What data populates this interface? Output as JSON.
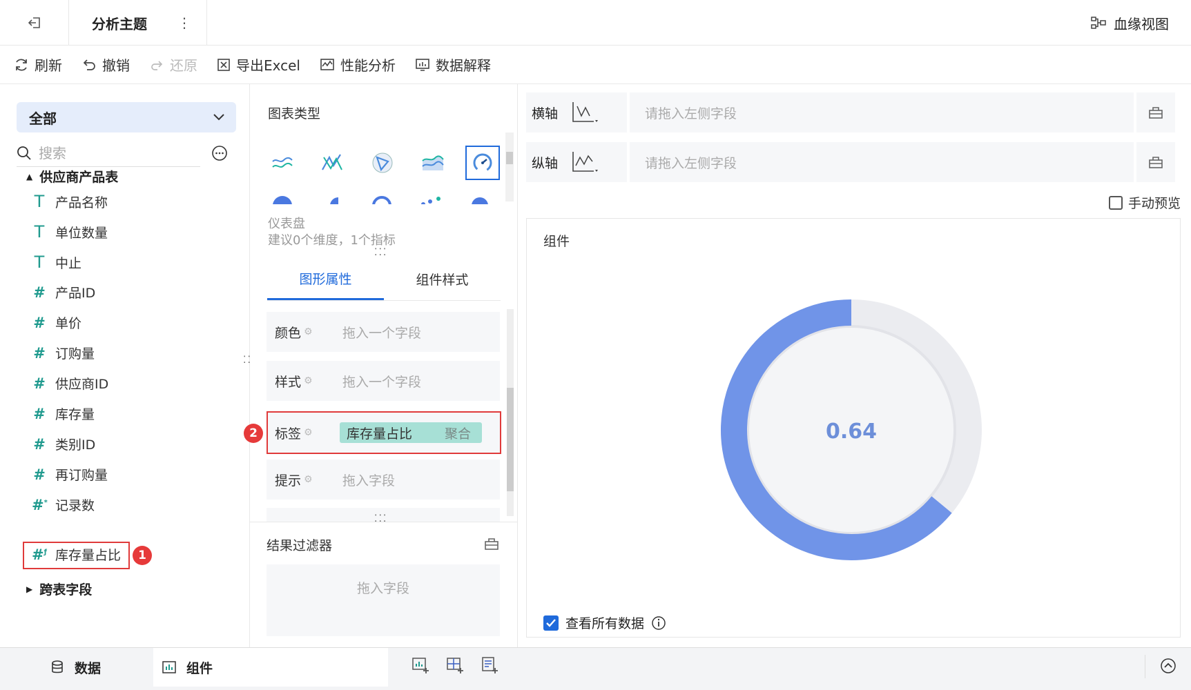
{
  "header": {
    "title": "分析主题",
    "lineage_label": "血缘视图"
  },
  "toolbar": {
    "refresh": "刷新",
    "undo": "撤销",
    "redo": "还原",
    "export_excel": "导出Excel",
    "performance": "性能分析",
    "explain": "数据解释"
  },
  "left": {
    "selector": "全部",
    "search_placeholder": "搜索",
    "table_name": "供应商产品表",
    "fields": [
      {
        "type": "text",
        "name": "产品名称"
      },
      {
        "type": "text",
        "name": "单位数量"
      },
      {
        "type": "text",
        "name": "中止"
      },
      {
        "type": "number",
        "name": "产品ID"
      },
      {
        "type": "number",
        "name": "单价"
      },
      {
        "type": "number",
        "name": "订购量"
      },
      {
        "type": "number",
        "name": "供应商ID"
      },
      {
        "type": "number",
        "name": "库存量"
      },
      {
        "type": "number",
        "name": "类别ID"
      },
      {
        "type": "number",
        "name": "再订购量"
      },
      {
        "type": "count",
        "name": "记录数"
      },
      {
        "type": "calc",
        "name": "库存量占比"
      }
    ],
    "cross_table": "跨表字段",
    "badge1": "1"
  },
  "middle": {
    "chart_type_label": "图表类型",
    "chart_name": "仪表盘",
    "chart_hint": "建议0个维度，1个指标",
    "tabs": [
      "图形属性",
      "组件样式"
    ],
    "props": {
      "color": {
        "label": "颜色",
        "placeholder": "拖入一个字段"
      },
      "style": {
        "label": "样式",
        "placeholder": "拖入一个字段"
      },
      "label": {
        "label": "标签",
        "chip": "库存量占比",
        "chip_agg": "聚合"
      },
      "tooltip": {
        "label": "提示",
        "placeholder": "拖入字段"
      }
    },
    "badge2": "2",
    "filter_label": "结果过滤器",
    "filter_placeholder": "拖入字段"
  },
  "right": {
    "x_axis": {
      "label": "横轴",
      "placeholder": "请拖入左侧字段"
    },
    "y_axis": {
      "label": "纵轴",
      "placeholder": "请拖入左侧字段"
    },
    "manual_preview": "手动预览",
    "component_title": "组件",
    "gauge_value": "0.64",
    "gauge_fraction": 0.64,
    "view_all": "查看所有数据"
  },
  "bottom": {
    "data_tab": "数据",
    "component_tab": "组件"
  },
  "colors": {
    "accent": "#1f6adb",
    "gauge": "#7094e8",
    "gauge_track": "#ebecf0",
    "chip": "#a7e0d6",
    "highlight": "#e03a3a"
  }
}
